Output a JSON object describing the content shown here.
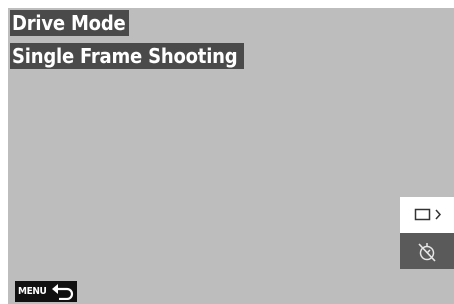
{
  "header": {
    "title": "Drive Mode",
    "subtitle": "Single Frame Shooting"
  },
  "side_menu": {
    "items": [
      {
        "icon": "single-frame-icon",
        "selected": true,
        "has_submenu": true
      },
      {
        "icon": "self-timer-off-icon",
        "selected": false,
        "has_submenu": false
      }
    ]
  },
  "footer": {
    "back_label": "MENU",
    "back_icon": "return-arrow-icon"
  },
  "colors": {
    "screen_background": "#bdbdbd",
    "label_background": "#4a4a4a",
    "selected_option_bg": "#ffffff",
    "unselected_option_bg": "#5a5a5a"
  }
}
